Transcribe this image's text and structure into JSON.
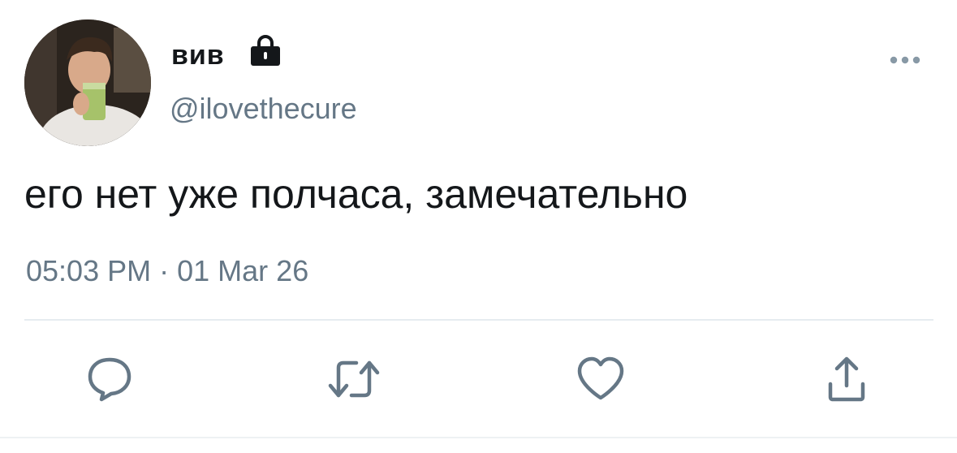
{
  "tweet": {
    "display_name": "вив",
    "handle": "@ilovethecure",
    "text": "его нет уже полчаса, замечательно",
    "time": "05:03 PM",
    "separator": "·",
    "date": "01 Mar 26",
    "protected": true
  },
  "icons": {
    "lock": "lock-icon",
    "more": "more-icon",
    "reply": "reply-icon",
    "retweet": "retweet-icon",
    "like": "heart-icon",
    "share": "share-icon"
  },
  "colors": {
    "text_primary": "#14171a",
    "text_secondary": "#657786",
    "icon_gray": "#657786",
    "divider": "#e6ecf0"
  }
}
